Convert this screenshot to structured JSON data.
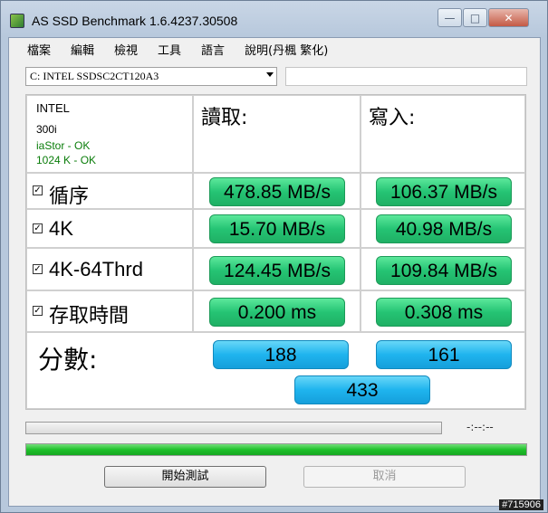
{
  "window": {
    "title": "AS SSD Benchmark 1.6.4237.30508",
    "minimize_glyph": "—",
    "maximize_glyph": "□",
    "close_glyph": "✕"
  },
  "menu": {
    "items": [
      "檔案",
      "編輯",
      "檢視",
      "工具",
      "語言",
      "說明(丹楓 繁化)"
    ]
  },
  "drive": {
    "selected": "C: INTEL SSDSC2CT120A3",
    "extra_field": ""
  },
  "info": {
    "vendor": "INTEL",
    "firmware": "300i",
    "driver_status": "iaStor - OK",
    "alignment_status": "1024 K - OK",
    "status_color": "#0a7d0a"
  },
  "columns": {
    "read": "讀取:",
    "write": "寫入:"
  },
  "rows": [
    {
      "label": "循序",
      "checked": true,
      "read": "478.85 MB/s",
      "write": "106.37 MB/s"
    },
    {
      "label": "4K",
      "checked": true,
      "read": "15.70 MB/s",
      "write": "40.98 MB/s"
    },
    {
      "label": "4K-64Thrd",
      "checked": true,
      "read": "124.45 MB/s",
      "write": "109.84 MB/s"
    },
    {
      "label": "存取時間",
      "checked": true,
      "read": "0.200 ms",
      "write": "0.308 ms"
    }
  ],
  "score": {
    "label": "分數:",
    "read": "188",
    "write": "161",
    "total": "433"
  },
  "progress": {
    "elapsed": "-:--:--",
    "overall_fraction": 1.0
  },
  "buttons": {
    "start": "開始測試",
    "cancel": "取消"
  },
  "watermark": "#715906",
  "colors": {
    "result_pill": "#25c474",
    "score_pill": "#1fb4ee",
    "progress_fill": "#1fc12b"
  }
}
